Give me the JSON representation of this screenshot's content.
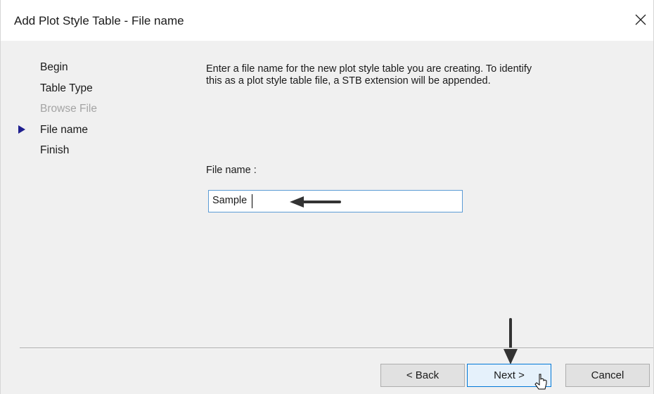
{
  "window": {
    "title": "Add Plot Style Table - File name"
  },
  "steps": [
    {
      "label": "Begin",
      "state": "normal"
    },
    {
      "label": "Table Type",
      "state": "normal"
    },
    {
      "label": "Browse File",
      "state": "disabled"
    },
    {
      "label": "File name",
      "state": "current"
    },
    {
      "label": "Finish",
      "state": "normal"
    }
  ],
  "main": {
    "description": "Enter a file name for the new plot style table you are creating. To identify this as a plot style table file, a STB extension will be appended.",
    "file_name_label": "File name :",
    "file_name_value": "Sample"
  },
  "buttons": {
    "back": "< Back",
    "next": "Next >",
    "cancel": "Cancel"
  },
  "icons": {
    "close": "close-icon",
    "step_pointer": "triangle-right-icon",
    "cursor": "mouse-pointer-icon"
  },
  "colors": {
    "accent": "#0078d7",
    "input_border": "#5b9bd5",
    "step_pointer": "#1f1f8f",
    "disabled_text": "#a4a4a4"
  }
}
